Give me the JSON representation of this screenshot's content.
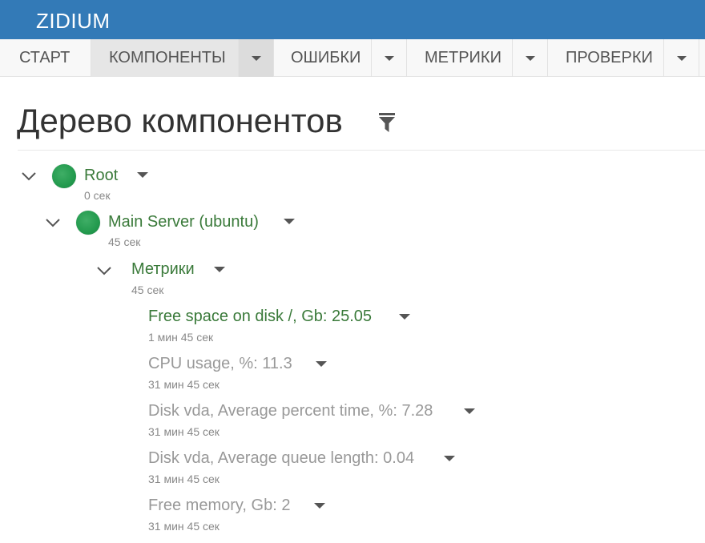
{
  "app": {
    "brand": "ZIDIUM"
  },
  "menu": {
    "items": [
      {
        "label": "СТАРТ"
      },
      {
        "label": "КОМПОНЕНТЫ"
      },
      {
        "label": "ОШИБКИ"
      },
      {
        "label": "МЕТРИКИ"
      },
      {
        "label": "ПРОВЕРКИ"
      }
    ],
    "active": "КОМПОНЕНТЫ"
  },
  "page": {
    "title": "Дерево компонентов",
    "filter_icon": "filter-icon"
  },
  "tree": {
    "root": {
      "name": "Root",
      "time": "0 сек",
      "status": "green"
    },
    "server": {
      "name": "Main Server (ubuntu)",
      "time": "45 сек",
      "status": "green"
    },
    "metrics_group": {
      "name": "Метрики",
      "time": "45 сек"
    },
    "metrics": [
      {
        "name": "Free space on disk /, Gb: 25.05",
        "time": "1 мин 45 сек",
        "state": "active"
      },
      {
        "name": "CPU usage, %: 11.3",
        "time": "31 мин 45 сек",
        "state": "inactive"
      },
      {
        "name": "Disk vda, Average percent time, %: 7.28",
        "time": "31 мин 45 сек",
        "state": "inactive"
      },
      {
        "name": "Disk vda, Average queue length: 0.04",
        "time": "31 мин 45 сек",
        "state": "inactive"
      },
      {
        "name": "Free memory, Gb: 2",
        "time": "31 мин 45 сек",
        "state": "inactive"
      }
    ]
  },
  "colors": {
    "header": "#337ab7",
    "status_ok": "#239a4e",
    "text_green": "#3a7a3a",
    "text_disabled": "#999999"
  }
}
